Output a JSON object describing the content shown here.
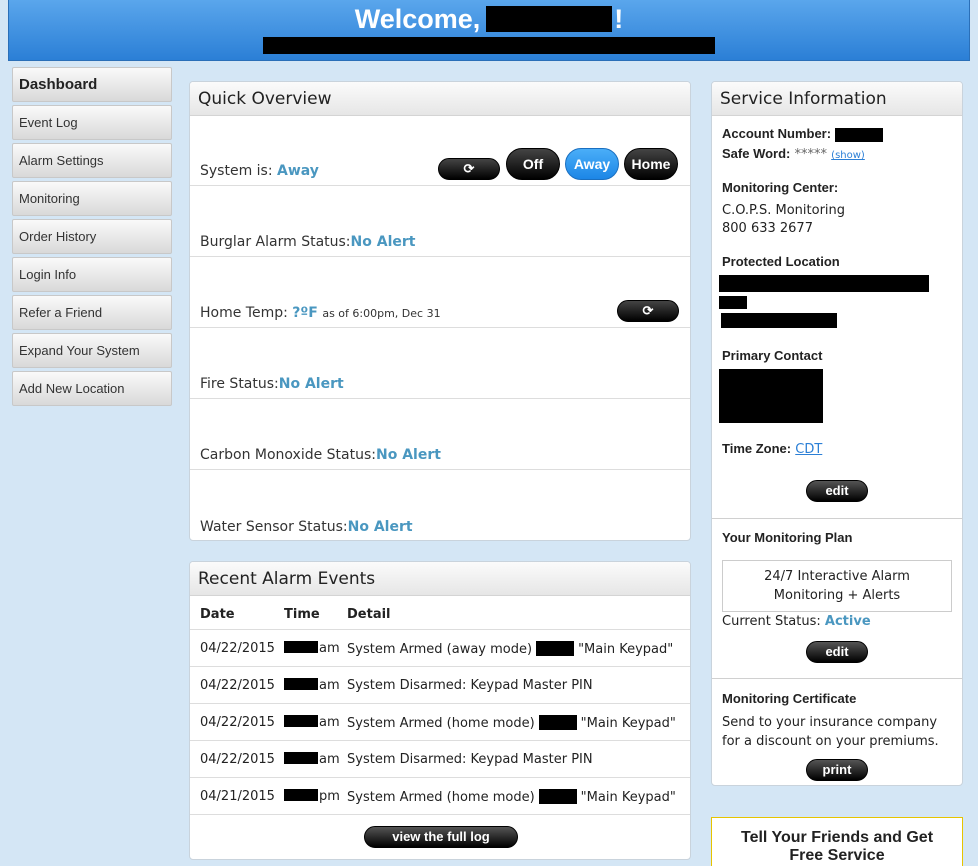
{
  "header": {
    "welcome": "Welcome,",
    "exclaim": "!"
  },
  "sidebar": {
    "items": [
      {
        "label": "Dashboard"
      },
      {
        "label": "Event Log"
      },
      {
        "label": "Alarm Settings"
      },
      {
        "label": "Monitoring"
      },
      {
        "label": "Order History"
      },
      {
        "label": "Login Info"
      },
      {
        "label": "Refer a Friend"
      },
      {
        "label": "Expand Your System"
      },
      {
        "label": "Add New Location"
      }
    ]
  },
  "overview": {
    "title": "Quick Overview",
    "system_label": "System is:",
    "system_value": "Away",
    "buttons": {
      "refresh": "⟳",
      "off": "Off",
      "away": "Away",
      "home": "Home"
    },
    "burglar_label": "Burglar Alarm Status:",
    "burglar_value": "No Alert",
    "temp_label": "Home Temp:",
    "temp_value": "?ºF",
    "temp_asof": "as of 6:00pm, Dec 31",
    "fire_label": "Fire Status:",
    "fire_value": "No Alert",
    "co_label": "Carbon Monoxide Status:",
    "co_value": "No Alert",
    "water_label": "Water Sensor Status:",
    "water_value": "No Alert"
  },
  "events": {
    "title": "Recent Alarm Events",
    "col_date": "Date",
    "col_time": "Time",
    "col_detail": "Detail",
    "rows": [
      {
        "date": "04/22/2015",
        "ampm": "am",
        "detail_a": "System Armed (away mode)",
        "detail_b": "\"Main Keypad\""
      },
      {
        "date": "04/22/2015",
        "ampm": "am",
        "detail_a": "System Disarmed: Keypad Master PIN",
        "detail_b": ""
      },
      {
        "date": "04/22/2015",
        "ampm": "am",
        "detail_a": "System Armed (home mode)",
        "detail_b": "\"Main Keypad\""
      },
      {
        "date": "04/22/2015",
        "ampm": "am",
        "detail_a": "System Disarmed: Keypad Master PIN",
        "detail_b": ""
      },
      {
        "date": "04/21/2015",
        "ampm": "pm",
        "detail_a": "System Armed (home mode)",
        "detail_b": "\"Main Keypad\""
      }
    ],
    "full_log": "view the full log"
  },
  "service": {
    "title": "Service Information",
    "account_label": "Account Number:",
    "safeword_label": "Safe Word:",
    "safeword_value": "*****",
    "show_link": "(show)",
    "center_label": "Monitoring Center:",
    "center_name": "C.O.P.S. Monitoring",
    "center_phone": "800 633 2677",
    "location_label": "Protected Location",
    "contact_label": "Primary Contact",
    "tz_label": "Time Zone:",
    "tz_value": "CDT",
    "edit": "edit",
    "plan_label": "Your Monitoring Plan",
    "plan_line1": "24/7 Interactive Alarm",
    "plan_line2": "Monitoring + Alerts",
    "status_label": "Current Status:",
    "status_value": "Active",
    "cert_label": "Monitoring Certificate",
    "cert_line1": "Send to your insurance company",
    "cert_line2": "for a discount on your premiums.",
    "print": "print"
  },
  "friends": {
    "line1": "Tell Your Friends and Get",
    "line2": "Free Service"
  }
}
